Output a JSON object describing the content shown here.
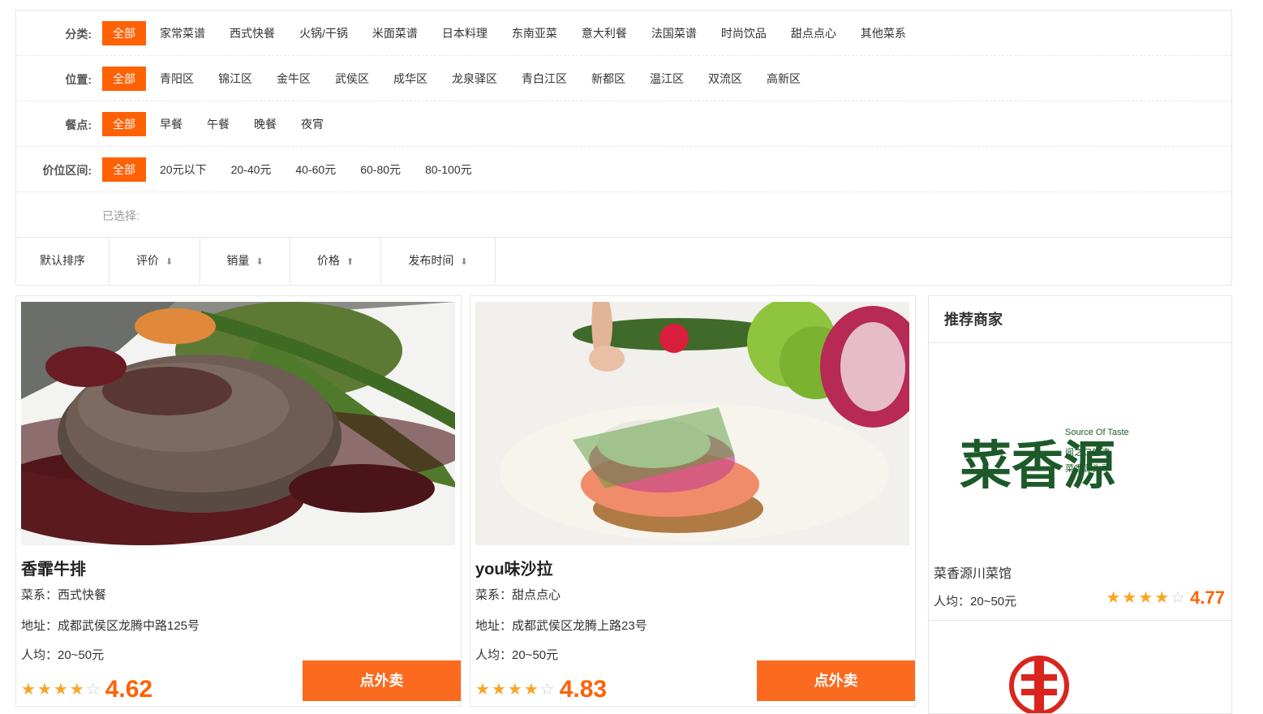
{
  "filters": {
    "category": {
      "label": "分类:",
      "options": [
        "全部",
        "家常菜谱",
        "西式快餐",
        "火锅/干锅",
        "米面菜谱",
        "日本料理",
        "东南亚菜",
        "意大利餐",
        "法国菜谱",
        "时尚饮品",
        "甜点点心",
        "其他菜系"
      ]
    },
    "location": {
      "label": "位置:",
      "options": [
        "全部",
        "青阳区",
        "锦江区",
        "金牛区",
        "武侯区",
        "成华区",
        "龙泉驿区",
        "青白江区",
        "新都区",
        "温江区",
        "双流区",
        "高新区"
      ]
    },
    "meal": {
      "label": "餐点:",
      "options": [
        "全部",
        "早餐",
        "午餐",
        "晚餐",
        "夜宵"
      ]
    },
    "price": {
      "label": "价位区间:",
      "options": [
        "全部",
        "20元以下",
        "20-40元",
        "40-60元",
        "60-80元",
        "80-100元"
      ]
    },
    "selected_label": "已选择:"
  },
  "sort": [
    {
      "label": "默认排序",
      "arrow": ""
    },
    {
      "label": "评价",
      "arrow": "down"
    },
    {
      "label": "销量",
      "arrow": "down"
    },
    {
      "label": "价格",
      "arrow": "up"
    },
    {
      "label": "发布时间",
      "arrow": "down"
    }
  ],
  "dishes": [
    {
      "name": "香霏牛排",
      "cuisine": "菜系：西式快餐",
      "address": "地址：成都武侯区龙腾中路125号",
      "avg": "人均：20~50元",
      "rating_stars": 4,
      "score": "4.62",
      "button": "点外卖"
    },
    {
      "name": "you味沙拉",
      "cuisine": "菜系：甜点点心",
      "address": "地址：成都武侯区龙腾上路23号",
      "avg": "人均：20~50元",
      "rating_stars": 4,
      "score": "4.83",
      "button": "点外卖"
    }
  ],
  "sidebar": {
    "title": "推荐商家",
    "merchants": [
      {
        "name": "菜香源川菜馆",
        "avg": "人均：20~50元",
        "rating_stars": 4,
        "score": "4.77",
        "logo_text": "菜香源",
        "logo_sub_en": "Source Of Taste",
        "logo_sub_1": "闻之口生津",
        "logo_sub_2": "菜香源头寻"
      }
    ]
  },
  "colors": {
    "accent": "#ff6105",
    "button": "#fb6a1f",
    "star": "#f6a623",
    "logo_green": "#1d5a2a",
    "logo_red": "#d9251d"
  }
}
